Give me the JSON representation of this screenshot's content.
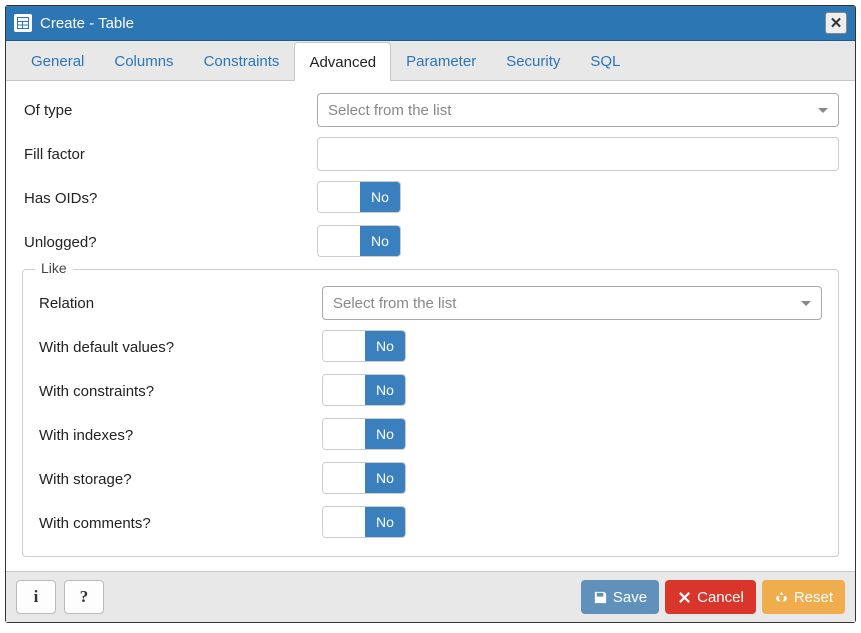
{
  "title": "Create - Table",
  "tabs": [
    {
      "label": "General",
      "active": false
    },
    {
      "label": "Columns",
      "active": false
    },
    {
      "label": "Constraints",
      "active": false
    },
    {
      "label": "Advanced",
      "active": true
    },
    {
      "label": "Parameter",
      "active": false
    },
    {
      "label": "Security",
      "active": false
    },
    {
      "label": "SQL",
      "active": false
    }
  ],
  "form": {
    "of_type": {
      "label": "Of type",
      "placeholder": "Select from the list"
    },
    "fill_factor": {
      "label": "Fill factor",
      "value": ""
    },
    "has_oids": {
      "label": "Has OIDs?",
      "value": "No"
    },
    "unlogged": {
      "label": "Unlogged?",
      "value": "No"
    },
    "like": {
      "legend": "Like",
      "relation": {
        "label": "Relation",
        "placeholder": "Select from the list"
      },
      "with_defaults": {
        "label": "With default values?",
        "value": "No"
      },
      "with_constraints": {
        "label": "With constraints?",
        "value": "No"
      },
      "with_indexes": {
        "label": "With indexes?",
        "value": "No"
      },
      "with_storage": {
        "label": "With storage?",
        "value": "No"
      },
      "with_comments": {
        "label": "With comments?",
        "value": "No"
      }
    }
  },
  "footer": {
    "info_tooltip": "i",
    "help_tooltip": "?",
    "save": "Save",
    "cancel": "Cancel",
    "reset": "Reset"
  }
}
